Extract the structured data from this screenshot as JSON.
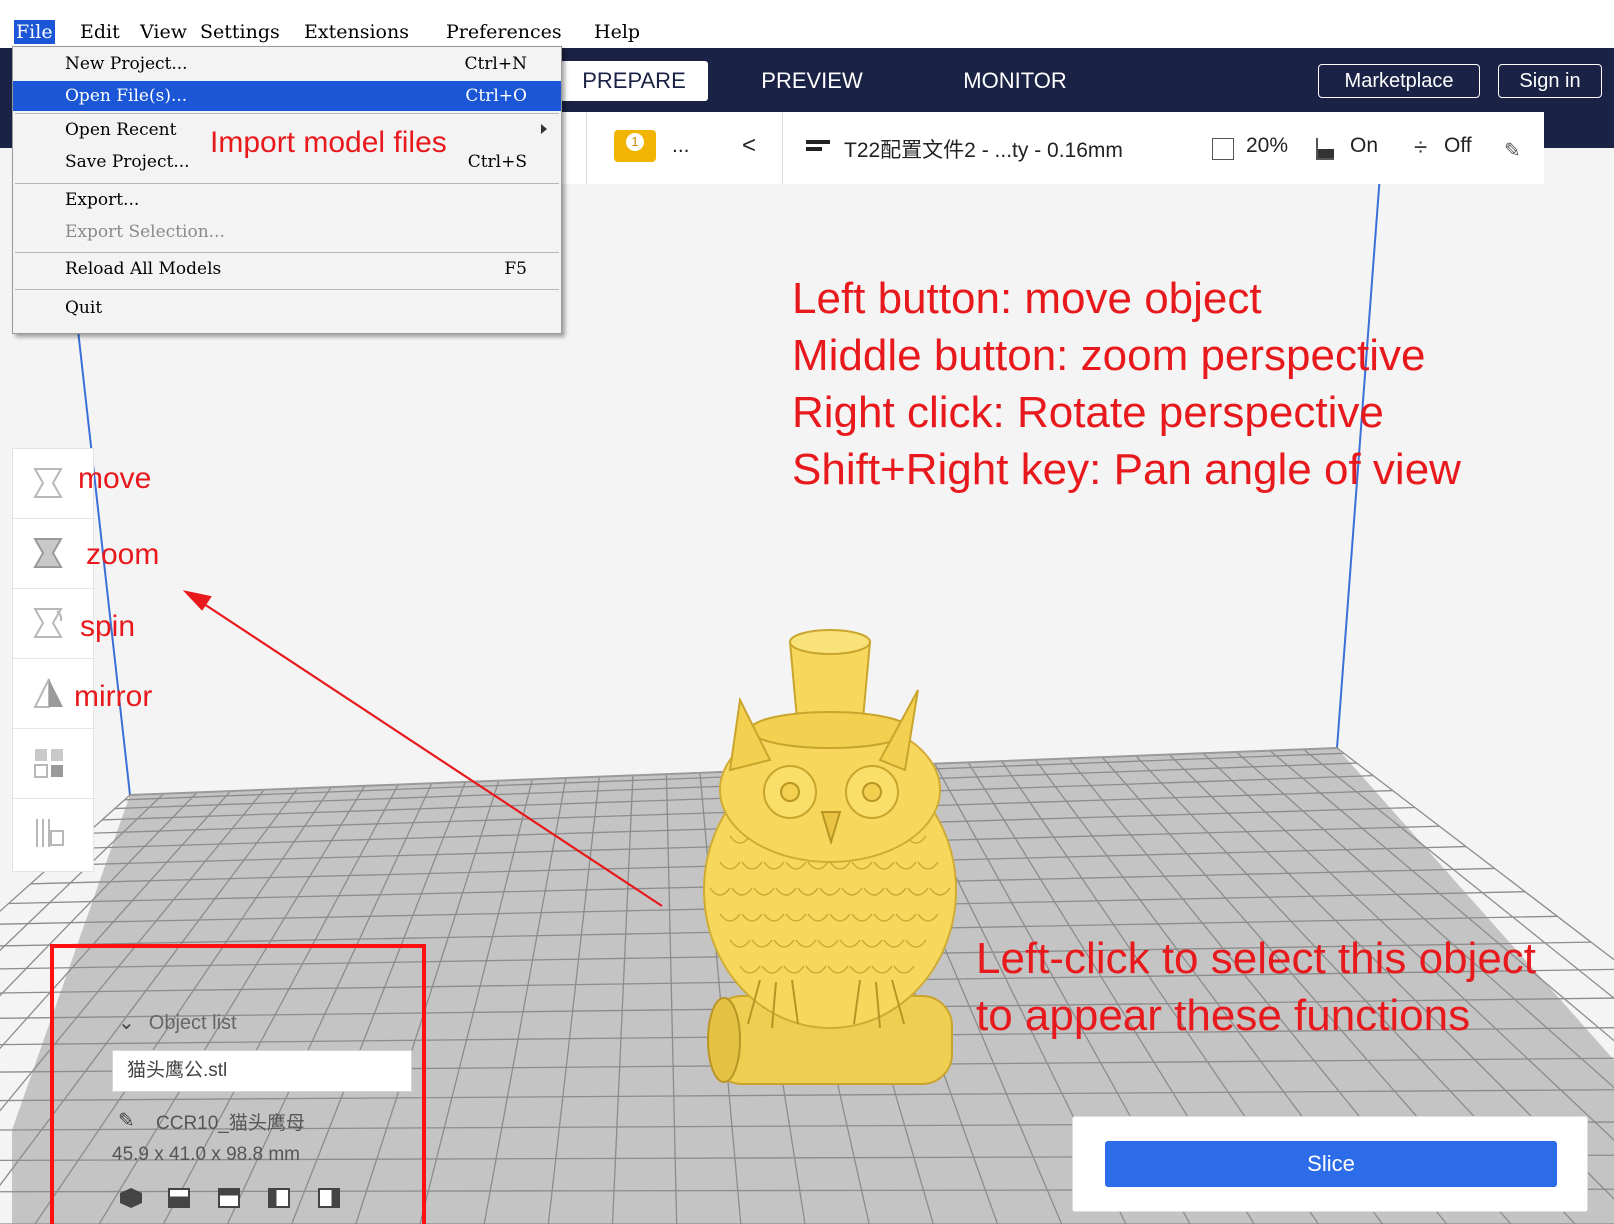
{
  "menubar": {
    "items": [
      "File",
      "Edit",
      "View",
      "Settings",
      "Extensions",
      "Preferences",
      "Help"
    ]
  },
  "header": {
    "stages": [
      "PREPARE",
      "PREVIEW",
      "MONITOR"
    ],
    "marketplace_label": "Marketplace",
    "signin_label": "Sign in"
  },
  "toolbar": {
    "warning_count": "1",
    "ellipsis": "...",
    "back_glyph": "<",
    "profile": "T22配置文件2 - ...ty - 0.16mm",
    "infill": "20%",
    "support": "On",
    "adhesion": "Off"
  },
  "file_menu": {
    "items": [
      {
        "label": "New Project...",
        "shortcut": "Ctrl+N"
      },
      {
        "label": "Open File(s)...",
        "shortcut": "Ctrl+O"
      },
      {
        "label": "Open Recent",
        "shortcut": ""
      },
      {
        "label": "Save Project...",
        "shortcut": "Ctrl+S"
      },
      {
        "label": "Export...",
        "shortcut": ""
      },
      {
        "label": "Export Selection...",
        "shortcut": ""
      },
      {
        "label": "Reload All Models",
        "shortcut": "F5"
      },
      {
        "label": "Quit",
        "shortcut": ""
      }
    ]
  },
  "annotations": {
    "import": "Import model files",
    "mouse_help": [
      "Left button: move object",
      "Middle button: zoom perspective",
      "Right click: Rotate perspective",
      "Shift+Right key: Pan angle of view"
    ],
    "select_hint": [
      "Left-click to select this object",
      "to appear these functions"
    ],
    "tools": [
      "move",
      "zoom",
      "spin",
      "mirror"
    ]
  },
  "object_list": {
    "header": "Object list",
    "file": "猫头鹰公.stl",
    "machine": "CCR10_猫头鹰母",
    "dimensions": "45.9 x 41.0 x 98.8 mm"
  },
  "slice": {
    "button_label": "Slice"
  },
  "colors": {
    "header_bg": "#1a2245",
    "annotation_red": "#e8191c",
    "menu_highlight": "#1a56d6",
    "slice_blue": "#2d6ce8",
    "model_yellow": "#f7d85c",
    "build_plate_grid": "#8c8c8c"
  },
  "icons": [
    "pencil-icon",
    "infill-icon",
    "support-icon",
    "adhesion-icon",
    "profile-icon",
    "warning-icon",
    "view-3d-icon",
    "view-front-icon",
    "view-top-icon",
    "view-left-icon",
    "view-right-icon"
  ]
}
